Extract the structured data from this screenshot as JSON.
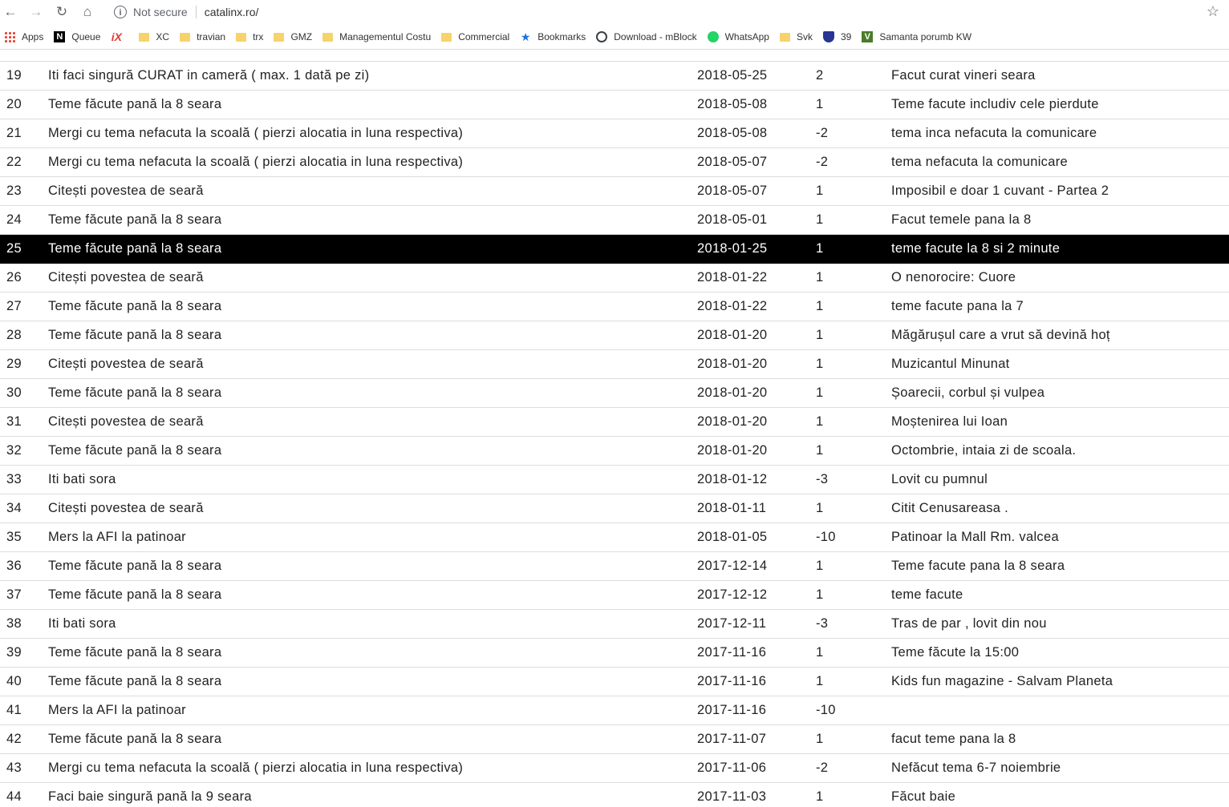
{
  "browser": {
    "security_label": "Not secure",
    "url": "catalinx.ro/"
  },
  "bookmarks": [
    {
      "label": "Apps",
      "icon": "apps-grid-icon"
    },
    {
      "label": "Queue",
      "icon": "n-logo-icon"
    },
    {
      "label": "",
      "icon": "x-logo-icon"
    },
    {
      "label": "XC",
      "icon": "folder-icon"
    },
    {
      "label": "travian",
      "icon": "folder-icon"
    },
    {
      "label": "trx",
      "icon": "folder-icon"
    },
    {
      "label": "GMZ",
      "icon": "folder-icon"
    },
    {
      "label": "Managementul Costu",
      "icon": "folder-icon"
    },
    {
      "label": "Commercial",
      "icon": "folder-icon"
    },
    {
      "label": "Bookmarks",
      "icon": "star-icon"
    },
    {
      "label": "Download - mBlock",
      "icon": "globe-icon"
    },
    {
      "label": "WhatsApp",
      "icon": "whatsapp-icon"
    },
    {
      "label": "Svk",
      "icon": "folder-icon"
    },
    {
      "label": "39",
      "icon": "shield-icon"
    },
    {
      "label": "Samanta porumb KW",
      "icon": "v-logo-icon"
    }
  ],
  "rows": [
    {
      "id": "19",
      "activity": "Iti faci singură CURAT in cameră ( max. 1 dată pe zi)",
      "date": "2018-05-25",
      "points": "2",
      "note": "Facut curat vineri seara"
    },
    {
      "id": "20",
      "activity": "Teme făcute pană la 8 seara",
      "date": "2018-05-08",
      "points": "1",
      "note": "Teme facute includiv cele pierdute"
    },
    {
      "id": "21",
      "activity": "Mergi cu tema nefacuta la scoală ( pierzi alocatia in luna respectiva)",
      "date": "2018-05-08",
      "points": "-2",
      "note": "tema inca nefacuta la comunicare"
    },
    {
      "id": "22",
      "activity": "Mergi cu tema nefacuta la scoală ( pierzi alocatia in luna respectiva)",
      "date": "2018-05-07",
      "points": "-2",
      "note": "tema nefacuta la comunicare"
    },
    {
      "id": "23",
      "activity": "Citești povestea de seară",
      "date": "2018-05-07",
      "points": "1",
      "note": "Imposibil e doar 1 cuvant - Partea 2"
    },
    {
      "id": "24",
      "activity": "Teme făcute pană la 8 seara",
      "date": "2018-05-01",
      "points": "1",
      "note": "Facut temele pana la 8"
    },
    {
      "id": "25",
      "activity": "Teme făcute pană la 8 seara",
      "date": "2018-01-25",
      "points": "1",
      "note": "teme facute la 8 si 2 minute",
      "selected": true
    },
    {
      "id": "26",
      "activity": "Citești povestea de seară",
      "date": "2018-01-22",
      "points": "1",
      "note": "O nenorocire: Cuore"
    },
    {
      "id": "27",
      "activity": "Teme făcute pană la 8 seara",
      "date": "2018-01-22",
      "points": "1",
      "note": "teme facute pana la 7"
    },
    {
      "id": "28",
      "activity": "Teme făcute pană la 8 seara",
      "date": "2018-01-20",
      "points": "1",
      "note": "Măgărușul care a vrut să devină hoț"
    },
    {
      "id": "29",
      "activity": "Citești povestea de seară",
      "date": "2018-01-20",
      "points": "1",
      "note": "Muzicantul Minunat"
    },
    {
      "id": "30",
      "activity": "Teme făcute pană la 8 seara",
      "date": "2018-01-20",
      "points": "1",
      "note": "Șoarecii, corbul și vulpea"
    },
    {
      "id": "31",
      "activity": "Citești povestea de seară",
      "date": "2018-01-20",
      "points": "1",
      "note": "Moștenirea lui Ioan"
    },
    {
      "id": "32",
      "activity": "Teme făcute pană la 8 seara",
      "date": "2018-01-20",
      "points": "1",
      "note": "Octombrie, intaia zi de scoala."
    },
    {
      "id": "33",
      "activity": "Iti bati sora",
      "date": "2018-01-12",
      "points": "-3",
      "note": "Lovit cu pumnul"
    },
    {
      "id": "34",
      "activity": "Citești povestea de seară",
      "date": "2018-01-11",
      "points": "1",
      "note": "Citit Cenusareasa ."
    },
    {
      "id": "35",
      "activity": "Mers la AFI la patinoar",
      "date": "2018-01-05",
      "points": "-10",
      "note": "Patinoar la Mall Rm. valcea"
    },
    {
      "id": "36",
      "activity": "Teme făcute pană la 8 seara",
      "date": "2017-12-14",
      "points": "1",
      "note": "Teme facute pana la 8 seara"
    },
    {
      "id": "37",
      "activity": "Teme făcute pană la 8 seara",
      "date": "2017-12-12",
      "points": "1",
      "note": "teme facute"
    },
    {
      "id": "38",
      "activity": "Iti bati sora",
      "date": "2017-12-11",
      "points": "-3",
      "note": "Tras de par          , lovit           din nou"
    },
    {
      "id": "39",
      "activity": "Teme făcute pană la 8 seara",
      "date": "2017-11-16",
      "points": "1",
      "note": "Teme făcute la 15:00"
    },
    {
      "id": "40",
      "activity": "Teme făcute pană la 8 seara",
      "date": "2017-11-16",
      "points": "1",
      "note": "Kids fun magazine - Salvam Planeta"
    },
    {
      "id": "41",
      "activity": "Mers la AFI la patinoar",
      "date": "2017-11-16",
      "points": "-10",
      "note": ""
    },
    {
      "id": "42",
      "activity": "Teme făcute pană la 8 seara",
      "date": "2017-11-07",
      "points": "1",
      "note": "                 facut teme pana la 8"
    },
    {
      "id": "43",
      "activity": "Mergi cu tema nefacuta la scoală ( pierzi alocatia in luna respectiva)",
      "date": "2017-11-06",
      "points": "-2",
      "note": "Nefăcut tema 6-7 noiembrie"
    },
    {
      "id": "44",
      "activity": "Faci baie singură pană la 9 seara",
      "date": "2017-11-03",
      "points": "1",
      "note": "Făcut baie"
    }
  ]
}
